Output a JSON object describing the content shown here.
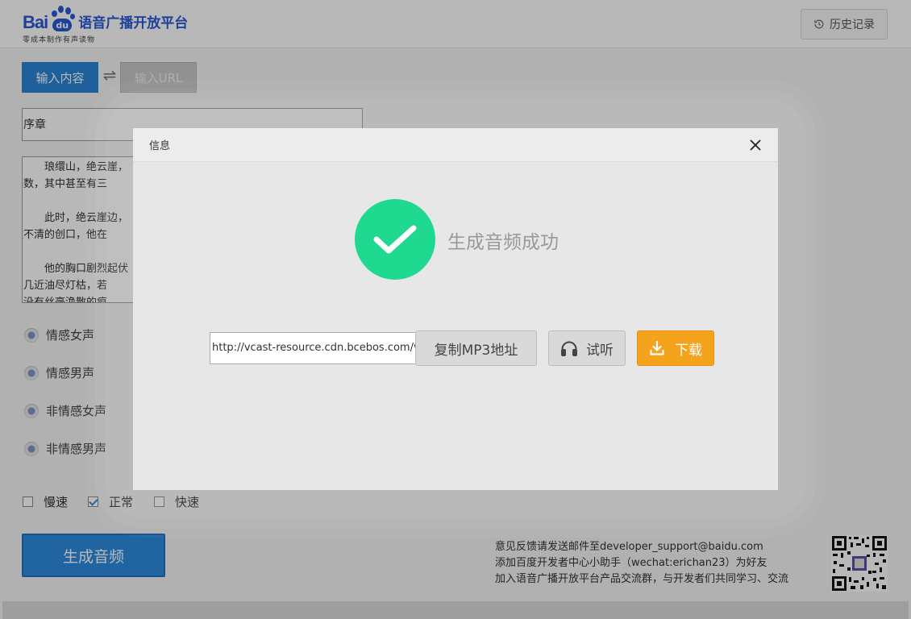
{
  "brand": {
    "logo_text": "Bai",
    "logo_pad_text": "du",
    "title": "语音广播开放平台",
    "subtitle": "零成本制作有声读物",
    "accent_color": "#2a59d6"
  },
  "header": {
    "history_label": "历史记录",
    "history_icon": "history-clock-icon"
  },
  "mode_tabs": {
    "text_label": "输入内容",
    "url_label": "输入URL",
    "swap_icon": "⇌"
  },
  "form": {
    "title_value": "序章",
    "content_paragraphs": [
      "琅缳山，绝云崖，",
      "计其数，其中甚至有三",
      "此时，绝云崖边，",
      "着数不清的创口，他在",
      "他的胸口剧烈起伏",
      "竭，几近油尽灯枯，若",
      "刃，没有丝毫涣散的痕"
    ]
  },
  "voices": [
    "情感女声",
    "情感男声",
    "非情感女声",
    "非情感男声"
  ],
  "speeds": [
    {
      "label": "慢速",
      "checked": false
    },
    {
      "label": "正常",
      "checked": true
    },
    {
      "label": "快速",
      "checked": false
    }
  ],
  "generate_label": "生成音频",
  "contact": {
    "line1": "意见反馈请发送邮件至developer_support@baidu.com",
    "line2": "添加百度开发者中心小助手（wechat:erichan23）为好友",
    "line3": "加入语音广播开放平台产品交流群，与开发者们共同学习、交流"
  },
  "dialog": {
    "title": "信息",
    "close_icon": "close-icon",
    "success_text": "生成音频成功",
    "url_value": "http://vcast-resource.cdn.bcebos.com/v",
    "copy_label": "复制MP3地址",
    "listen_label": "试听",
    "download_label": "下载",
    "success_color": "#1ed98f",
    "download_color": "#f5a31d"
  }
}
